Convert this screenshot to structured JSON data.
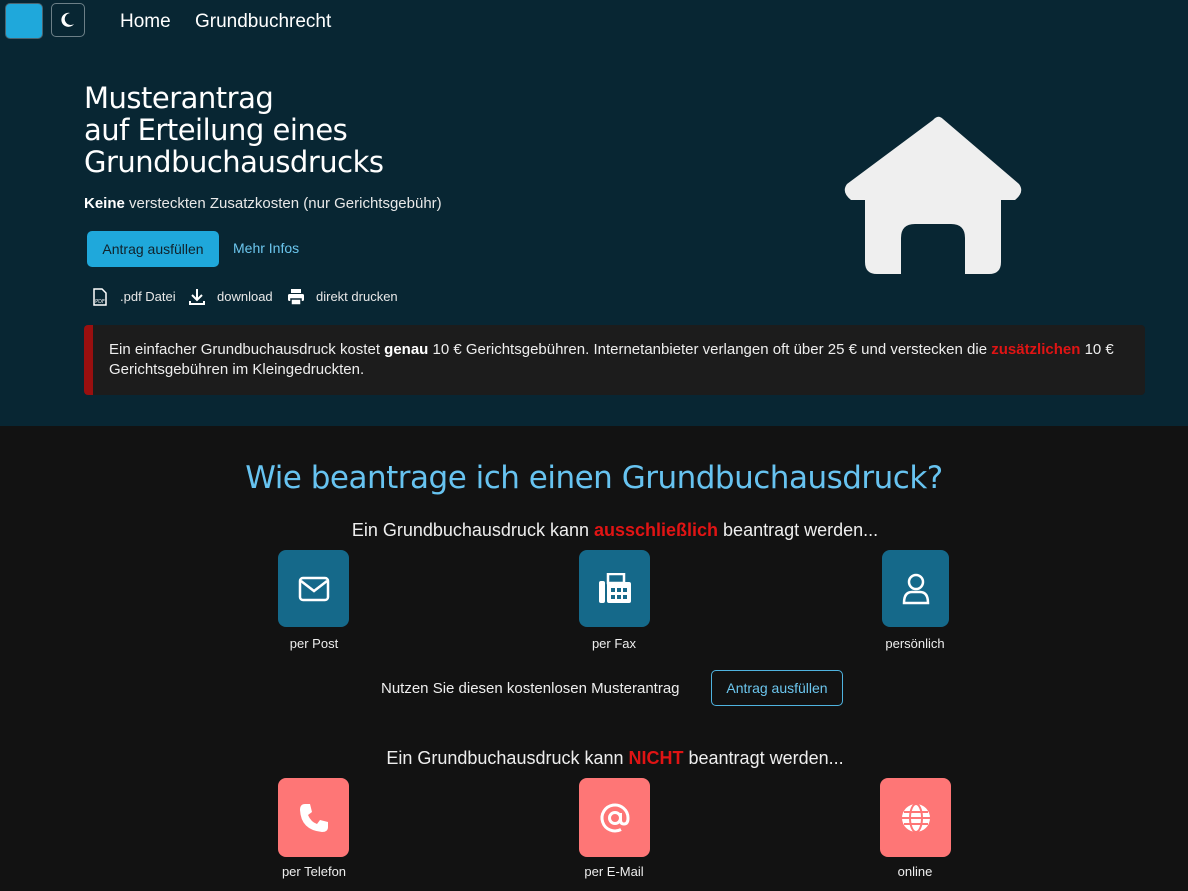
{
  "colors": {
    "hero_bg": "#082633",
    "page_bg": "#121212",
    "accent": "#1fa8db",
    "link": "#6cc6ee",
    "heading": "#67c3f0",
    "danger": "#e01414",
    "tile_allowed": "#15698a",
    "tile_forbidden": "#fe7676"
  },
  "topbar": {
    "color_toggle_icon": "color-swatch",
    "theme_toggle_icon": "moon-icon",
    "nav": [
      "Home",
      "Grundbuchrecht"
    ]
  },
  "hero": {
    "title_lines": [
      "Musterantrag",
      "auf Erteilung eines",
      "Grundbuchausdrucks"
    ],
    "subtitle_bold": "Keine",
    "subtitle_rest": " versteckten Zusatzkosten (nur Gerichtsgebühr)",
    "primary_button": "Antrag ausfüllen",
    "info_link": "Mehr Infos",
    "file_items": [
      {
        "icon": "pdf-icon",
        "label": ".pdf Datei"
      },
      {
        "icon": "download-icon",
        "label": "download"
      },
      {
        "icon": "printer-icon",
        "label": "direkt drucken"
      }
    ],
    "image_icon": "house-icon"
  },
  "alert": {
    "part1": "Ein einfacher Grundbuchausdruck kostet ",
    "bold": "genau",
    "part2": " 10 € Gerichtsgebühren. Internetanbieter verlangen oft über 25 € und verstecken die ",
    "red": "zusätzlichen",
    "part3": " 10 € Gerichtsgebühren im Kleingedruckten."
  },
  "section": {
    "heading": "Wie beantrage ich einen Grundbuchausdruck?",
    "allowed_intro": {
      "before": "Ein Grundbuchausdruck kann ",
      "red": "ausschließlich",
      "after": " beantragt werden..."
    },
    "allowed": [
      {
        "icon": "envelope-icon",
        "label": "per Post"
      },
      {
        "icon": "fax-icon",
        "label": "per Fax"
      },
      {
        "icon": "person-icon",
        "label": "persönlich"
      }
    ],
    "cta_text": "Nutzen Sie diesen kostenlosen Musterantrag",
    "cta_button": "Antrag ausfüllen",
    "forbidden_intro": {
      "before": "Ein Grundbuchausdruck kann ",
      "red": "NICHT",
      "after": " beantragt werden..."
    },
    "forbidden": [
      {
        "icon": "phone-icon",
        "label": "per Telefon"
      },
      {
        "icon": "at-icon",
        "label": "per E-Mail"
      },
      {
        "icon": "globe-icon",
        "label": "online"
      }
    ]
  }
}
